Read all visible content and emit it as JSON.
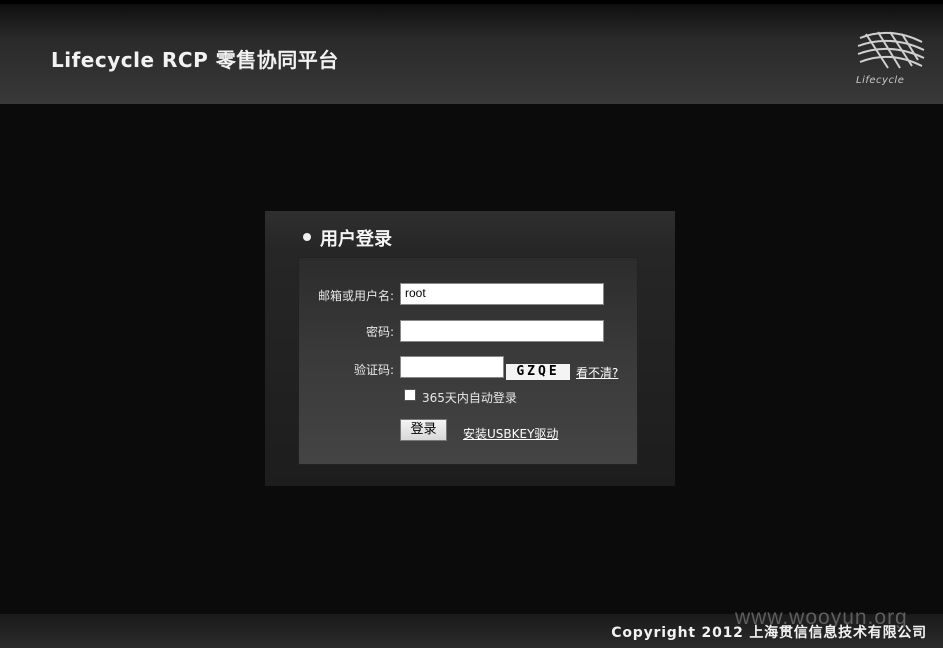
{
  "header": {
    "title": "Lifecycle RCP 零售协同平台",
    "logo_text": "Lifecycle",
    "logo_icon": "lifecycle-globe-icon"
  },
  "login": {
    "panel_title": "用户登录",
    "username_label": "邮箱或用户名:",
    "username_value": "root",
    "password_label": "密码:",
    "password_value": "",
    "captcha_label": "验证码:",
    "captcha_value": "",
    "captcha_image_text": "GZQE",
    "refresh_captcha": "看不清?",
    "remember_label": "365天内自动登录",
    "remember_checked": false,
    "login_button": "登录",
    "install_usbkey": "安装USBKEY驱动"
  },
  "footer": {
    "copyright": "Copyright 2012 上海贯信信息技术有限公司",
    "watermark": "www.wooyun.org"
  },
  "colors": {
    "background": "#0b0b0b",
    "panel": "#262626",
    "form": "#3a3a3a"
  }
}
